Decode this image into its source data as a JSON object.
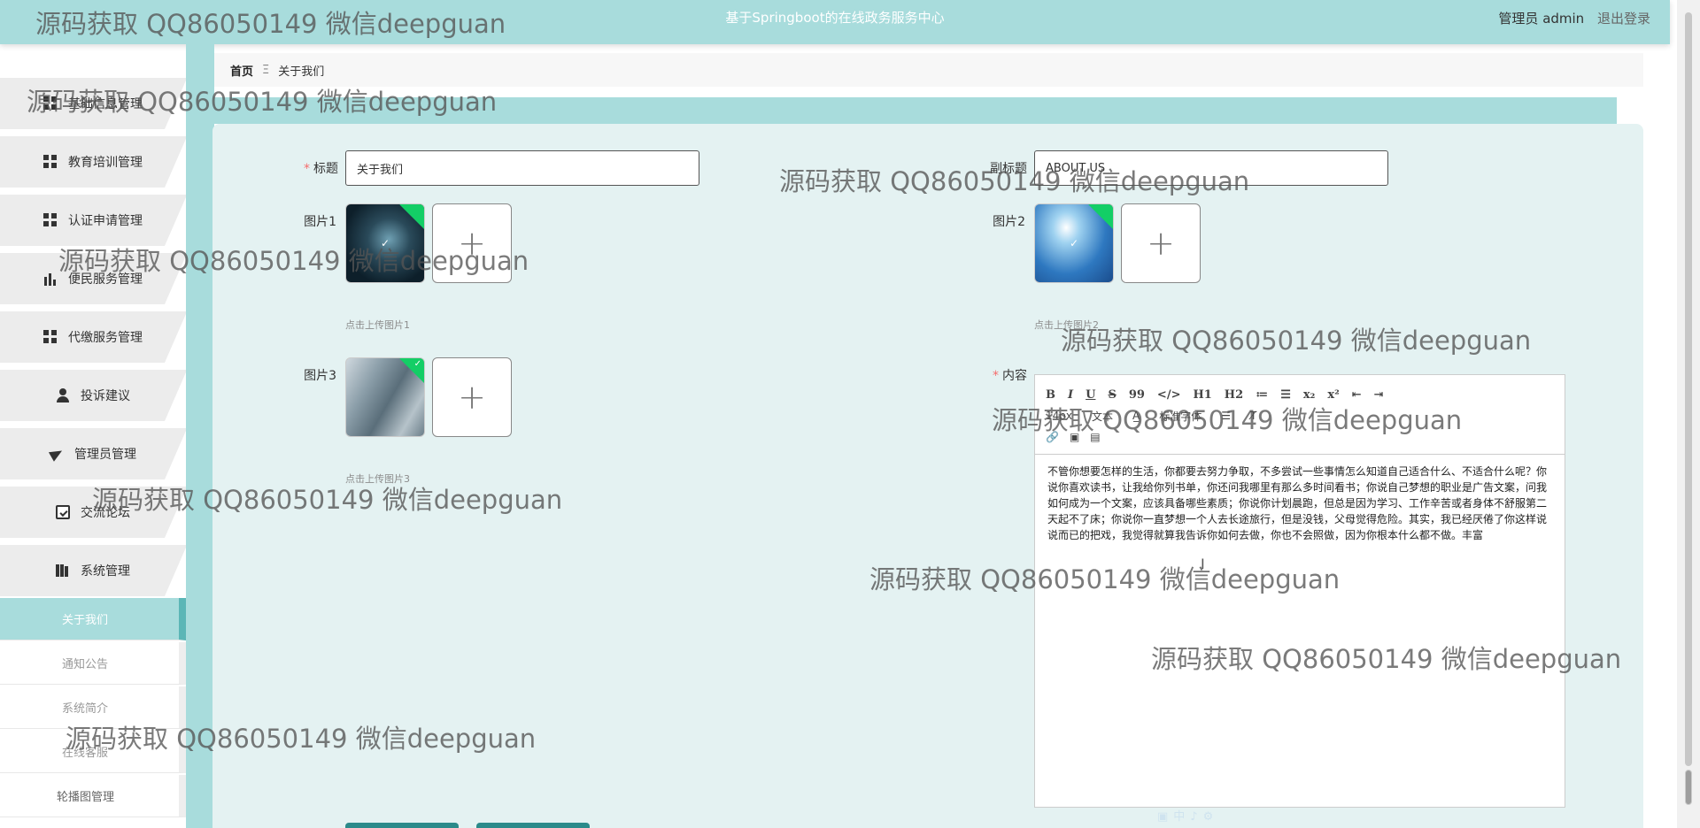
{
  "header": {
    "title": "基于Springboot的在线政务服务中心",
    "user_label": "管理员 admin",
    "logout_label": "退出登录"
  },
  "sidebar": {
    "items": [
      {
        "label": "基础信息管理",
        "icon": "grid-icon"
      },
      {
        "label": "教育培训管理",
        "icon": "grid-icon"
      },
      {
        "label": "认证申请管理",
        "icon": "grid-icon"
      },
      {
        "label": "便民服务管理",
        "icon": "bar-chart-icon"
      },
      {
        "label": "代缴服务管理",
        "icon": "grid-icon"
      },
      {
        "label": "投诉建议",
        "icon": "user-icon"
      },
      {
        "label": "管理员管理",
        "icon": "paper-plane-icon"
      },
      {
        "label": "交流论坛",
        "icon": "clipboard-check-icon"
      },
      {
        "label": "系统管理",
        "icon": "books-icon"
      }
    ],
    "submenu": [
      {
        "label": "关于我们"
      },
      {
        "label": "通知公告"
      },
      {
        "label": "系统简介"
      },
      {
        "label": "在线客服"
      },
      {
        "label": "轮播图管理"
      }
    ]
  },
  "breadcrumb": {
    "home": "首页",
    "separator": "Ξ",
    "current": "关于我们"
  },
  "form": {
    "title_label": "标题",
    "title_value": "关于我们",
    "subtitle_label": "副标题",
    "subtitle_value": "ABOUT US",
    "image1_label": "图片1",
    "image1_hint": "点击上传图片1",
    "image2_label": "图片2",
    "image2_hint": "点击上传图片2",
    "image3_label": "图片3",
    "image3_hint": "点击上传图片3",
    "content_label": "内容",
    "upload_plus": "+",
    "toolbar": {
      "row1": [
        "B",
        "I",
        "U",
        "S",
        "99",
        "</>",
        "H1",
        "H2",
        "≔",
        "☰",
        "x₂",
        "x²",
        "⇤",
        "⇥"
      ],
      "row2": [
        "14px",
        "文本",
        "标准字体"
      ],
      "row3": [
        "link-icon",
        "image-icon",
        "video-icon"
      ]
    },
    "content_text": "不管你想要怎样的生活，你都要去努力争取，不多尝试一些事情怎么知道自己适合什么、不适合什么呢？你说你喜欢读书，让我给你列书单，你还问我哪里有那么多时间看书；你说自己梦想的职业是广告文案，问我如何成为一个文案，应该具备哪些素质；你说你计划晨跑，但总是因为学习、工作辛苦或者身体不舒服第二天起不了床；你说你一直梦想一个人去长途旅行，但是没钱，父母觉得危险。其实，我已经厌倦了你这样说说而已的把戏，我觉得就算我告诉你如何去做，你也不会照做，因为你根本什么都不做。丰富"
  },
  "watermark_text": "源码获取 QQ86050149 微信deepguan",
  "colors": {
    "header_bg": "#a8dcdc",
    "panel_bg": "#e4f2f2",
    "active_menu": "#a8dcdc",
    "required": "#f56c6c",
    "upload_success": "#13ce66"
  }
}
